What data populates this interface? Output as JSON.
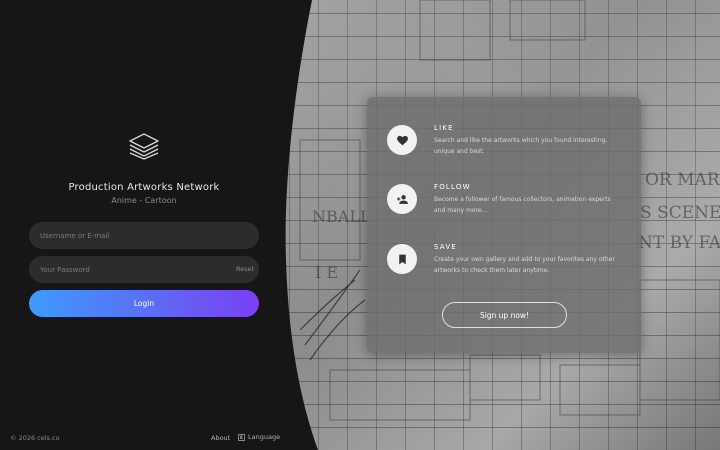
{
  "brand": {
    "title": "Production Artworks Network",
    "subtitle": "Anime - Cartoon",
    "icon": "layers-icon"
  },
  "login": {
    "username_placeholder": "Username or E-mail",
    "password_placeholder": "Your Password",
    "reset_label": "Reset",
    "login_label": "Login",
    "gradient_start": "#3e9bfb",
    "gradient_end": "#7b3ff5"
  },
  "footer": {
    "copyright": "© 2026 cels.co",
    "about": "About",
    "language": "Language"
  },
  "features": [
    {
      "icon": "heart-icon",
      "title": "LIKE",
      "description": "Search and like the artworks which you found interesting, unique and best."
    },
    {
      "icon": "add-user-icon",
      "title": "FOLLOW",
      "description": "Become a follower of famous collectors, animation experts and many more..."
    },
    {
      "icon": "bookmark-icon",
      "title": "SAVE",
      "description": "Create your own gallery and add to your favorites any other artworks to check them later anytime."
    }
  ],
  "signup_label": "Sign up now!"
}
